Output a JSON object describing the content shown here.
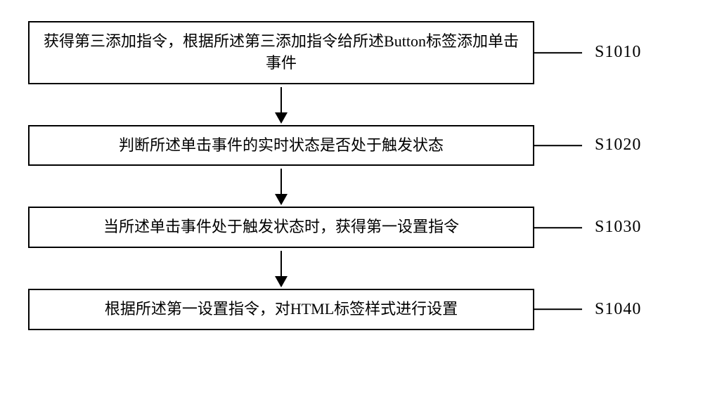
{
  "flow": {
    "steps": [
      {
        "text": "获得第三添加指令，根据所述第三添加指令给所述Button标签添加单击事件",
        "label": "S1010"
      },
      {
        "text": "判断所述单击事件的实时状态是否处于触发状态",
        "label": "S1020"
      },
      {
        "text": "当所述单击事件处于触发状态时，获得第一设置指令",
        "label": "S1030"
      },
      {
        "text": "根据所述第一设置指令，对HTML标签样式进行设置",
        "label": "S1040"
      }
    ]
  }
}
